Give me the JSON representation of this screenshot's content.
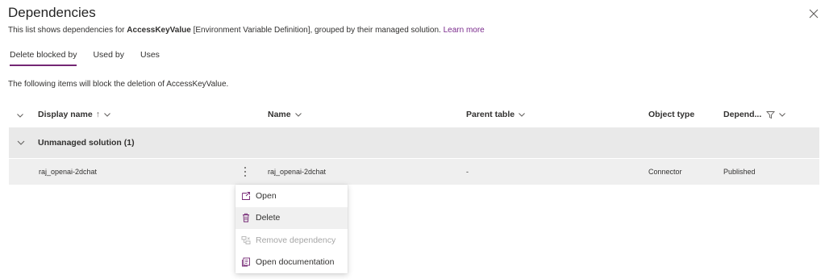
{
  "panel": {
    "title": "Dependencies",
    "subtitle_prefix": "This list shows dependencies for ",
    "subtitle_bold": "AccessKeyValue",
    "subtitle_suffix": " [Environment Variable Definition], grouped by their managed solution. ",
    "learn_more": "Learn more",
    "close_icon": "close-icon"
  },
  "tabs": [
    {
      "label": "Delete blocked by",
      "active": true
    },
    {
      "label": "Used by",
      "active": false
    },
    {
      "label": "Uses",
      "active": false
    }
  ],
  "info_text": "The following items will block the deletion of AccessKeyValue.",
  "columns": {
    "display_name": "Display name",
    "display_sort": "↑",
    "name": "Name",
    "parent_table": "Parent table",
    "object_type": "Object type",
    "dependency": "Depend..."
  },
  "group": {
    "label": "Unmanaged solution (1)"
  },
  "rows": [
    {
      "display_name": "raj_openai-2dchat",
      "name": "raj_openai-2dchat",
      "parent_table": "-",
      "object_type": "Connector",
      "dependency": "Published"
    }
  ],
  "context_menu": [
    {
      "label": "Open",
      "icon": "open-icon",
      "enabled": true
    },
    {
      "label": "Delete",
      "icon": "trash-icon",
      "enabled": true
    },
    {
      "label": "Remove dependency",
      "icon": "remove-dependency-icon",
      "enabled": false
    },
    {
      "label": "Open documentation",
      "icon": "documentation-icon",
      "enabled": true
    }
  ],
  "colors": {
    "accent": "#742774",
    "link": "#7a2a8c",
    "group_bg": "#e9e9e9",
    "row_bg": "#efefef"
  }
}
